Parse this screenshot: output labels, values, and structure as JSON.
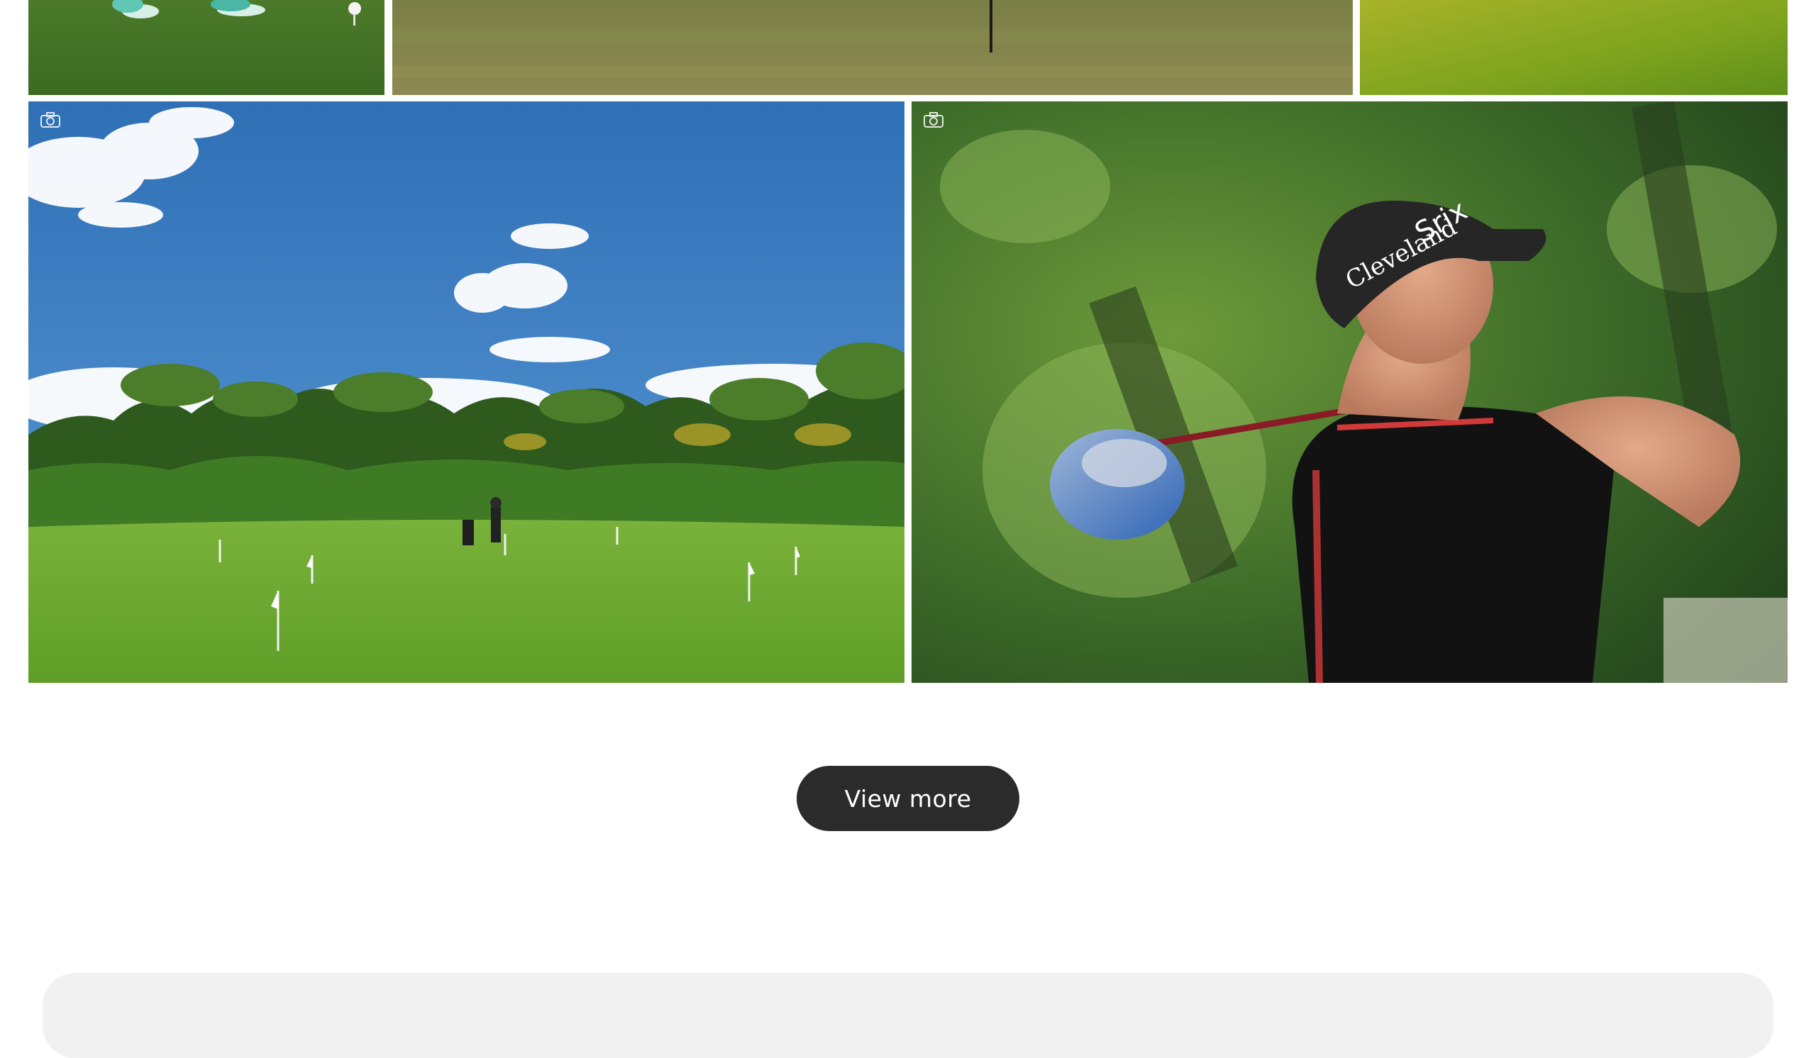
{
  "gallery": {
    "photos": [
      {
        "subject": "golfer feet with ball on tee"
      },
      {
        "subject": "fairway with flagstick"
      },
      {
        "subject": "bright green fairway"
      },
      {
        "subject": "putting green with palm trees and blue sky"
      },
      {
        "subject": "golfer mid-swing close-up"
      }
    ],
    "camera_icon": "camera-icon"
  },
  "view_more_label": "View more",
  "colors": {
    "button_bg": "#2b2b2b",
    "button_text": "#ffffff",
    "footer_panel_bg": "#f1f1f1"
  }
}
